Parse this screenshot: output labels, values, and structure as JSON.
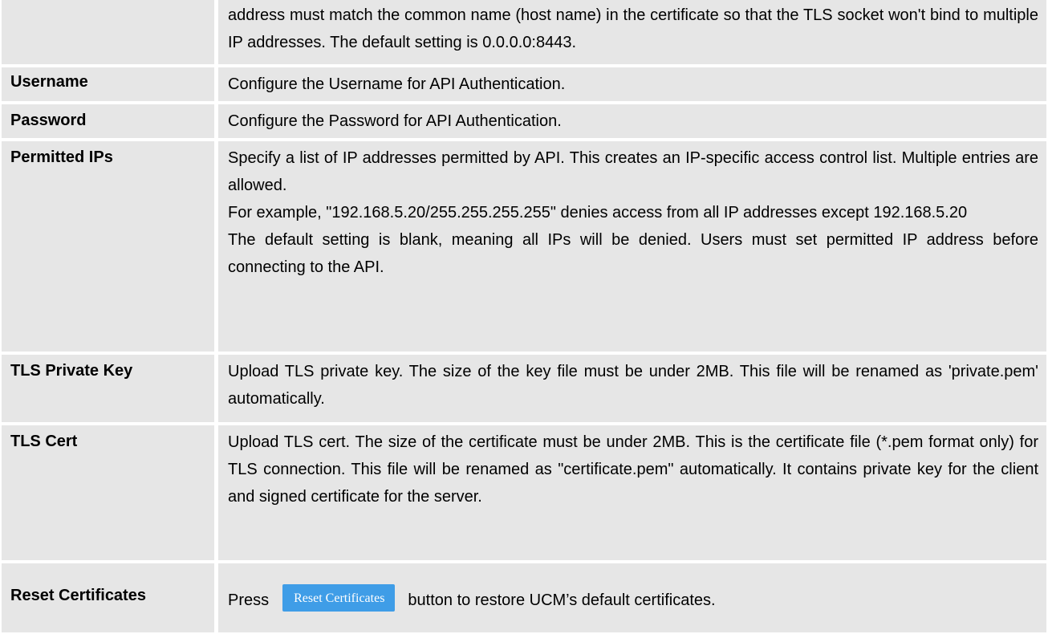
{
  "rows": [
    {
      "label": "",
      "lines": [
        "address must match the common name (host name) in the certificate so that the TLS socket won't bind to multiple IP addresses. The default setting is 0.0.0.0:8443."
      ]
    },
    {
      "label": "Username",
      "lines": [
        "Configure the Username for API Authentication."
      ]
    },
    {
      "label": "Password",
      "lines": [
        "Configure the Password for API Authentication."
      ]
    },
    {
      "label": "Permitted IPs",
      "lines": [
        "Specify a list of IP addresses permitted by API. This creates an IP-specific access control list. Multiple entries are allowed.",
        "For example, \"192.168.5.20/255.255.255.255\" denies access from all IP addresses except 192.168.5.20",
        "The default setting is blank, meaning all IPs will be denied. Users must set permitted IP address before connecting to the API."
      ]
    },
    {
      "label": "TLS Private Key",
      "lines": [
        "Upload TLS private key. The size of the key file must be under 2MB. This file will be renamed as 'private.pem' automatically."
      ]
    },
    {
      "label": "TLS Cert",
      "lines": [
        "Upload TLS cert. The size of the certificate must be under 2MB. This is the certificate file (*.pem format only) for TLS connection. This file will be renamed as \"certificate.pem\" automatically. It contains private key for the client and signed certificate for the server."
      ]
    },
    {
      "label": "Reset Certificates",
      "before_button": "Press",
      "button_label": "Reset Certificates",
      "after_button": "button to restore UCM’s default certificates."
    }
  ]
}
